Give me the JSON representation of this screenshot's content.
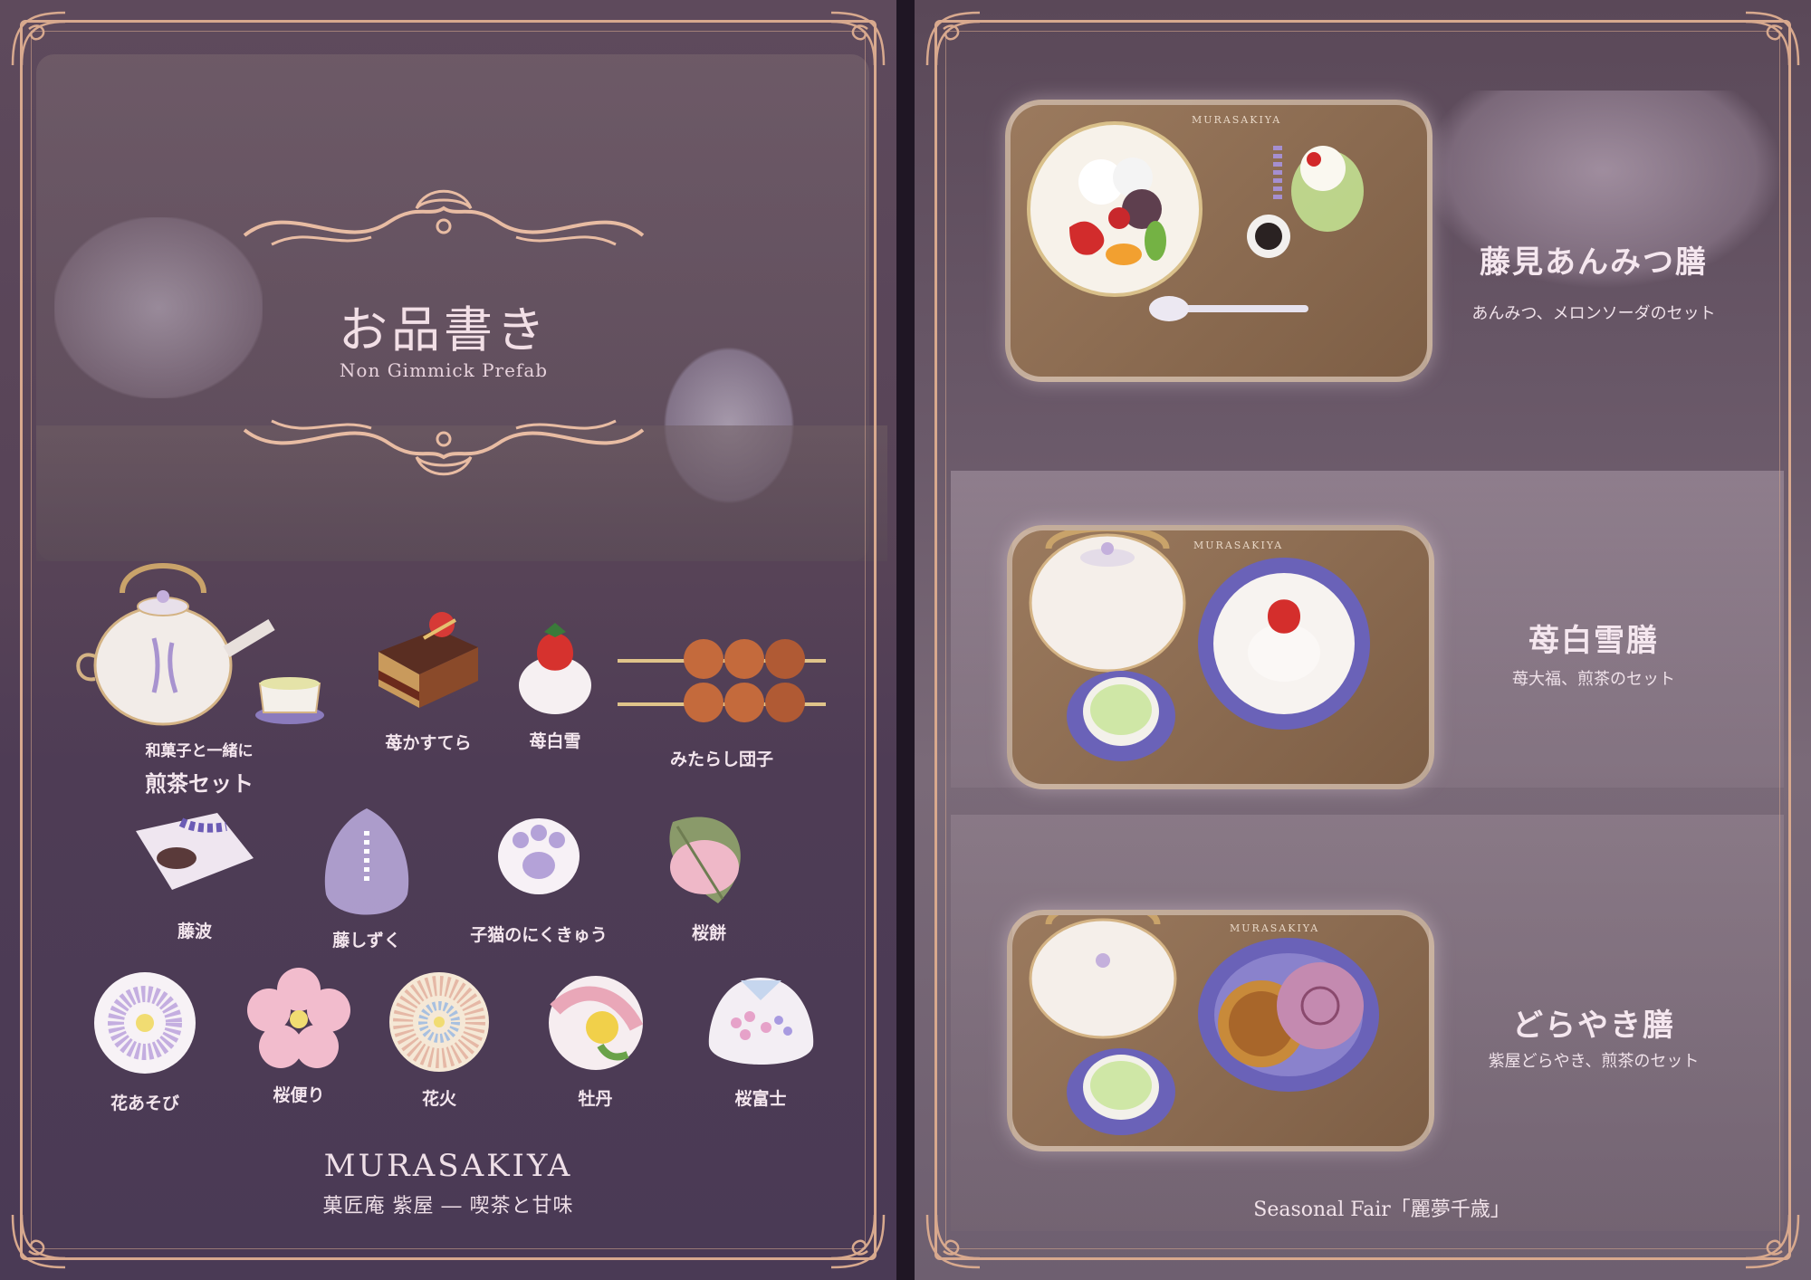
{
  "menu": {
    "title": "お品書き",
    "subtitle": "Non Gimmick Prefab"
  },
  "sweets": [
    {
      "label_top": "和菓子と一緒に",
      "label": "煎茶セット",
      "icon": "teapot-set-icon"
    },
    {
      "label": "苺かすてら",
      "icon": "castella-icon"
    },
    {
      "label": "苺白雪",
      "icon": "strawberry-daifuku-icon"
    },
    {
      "label": "みたらし団子",
      "icon": "dango-icon"
    },
    {
      "label": "藤波",
      "icon": "fujinami-icon"
    },
    {
      "label": "藤しずく",
      "icon": "fujishizuku-icon"
    },
    {
      "label": "子猫のにくきゅう",
      "icon": "paw-icon"
    },
    {
      "label": "桜餅",
      "icon": "sakuramochi-icon"
    },
    {
      "label": "花あそび",
      "icon": "chrysanthemum-icon"
    },
    {
      "label": "桜便り",
      "icon": "sakura-icon"
    },
    {
      "label": "花火",
      "icon": "hanabi-icon"
    },
    {
      "label": "牡丹",
      "icon": "peony-icon"
    },
    {
      "label": "桜富士",
      "icon": "sakura-fuji-icon"
    }
  ],
  "brand": {
    "name": "MURASAKIYA",
    "tagline": "菓匠庵 紫屋 ― 喫茶と甘味"
  },
  "sets": [
    {
      "title": "藤見あんみつ膳",
      "desc": "あんみつ、メロンソーダのセット",
      "tray_brand": "MURASAKIYA"
    },
    {
      "title": "苺白雪膳",
      "desc": "苺大福、煎茶のセット",
      "tray_brand": "MURASAKIYA"
    },
    {
      "title": "どらやき膳",
      "desc": "紫屋どらやき、煎茶のセット",
      "tray_brand": "MURASAKIYA"
    }
  ],
  "fair": "Seasonal Fair「麗夢千歳」",
  "colors": {
    "frame": "#d8a98e",
    "panel_left": "#574357",
    "panel_right": "#6b5a6a",
    "text": "#f4e6ee",
    "tray_wood": "#8a6a50"
  }
}
